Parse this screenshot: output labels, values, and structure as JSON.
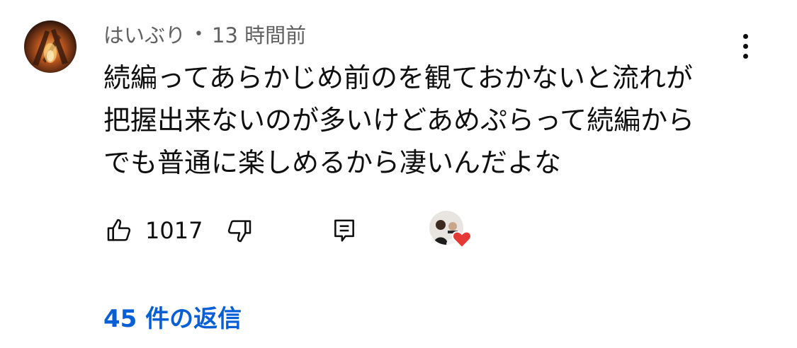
{
  "comment": {
    "author": "はいぶり",
    "separator": "•",
    "timestamp": "13 時間前",
    "text_lines": [
      "続編ってあらかじめ前のを観ておかないと流れが",
      "把握出来ないのが多いけどあめぷらって続編から",
      "でも普通に楽しめるから凄いんだよな"
    ]
  },
  "actions": {
    "like_icon": "thumbs-up-icon",
    "like_count": "1017",
    "dislike_icon": "thumbs-down-icon",
    "reply_icon": "reply-comment-icon",
    "creator_heart_icon": "heart-icon",
    "heart_color": "#e53935"
  },
  "replies": {
    "label": "45 件の返信",
    "color": "#065fd4"
  },
  "menu": {
    "icon": "more-vertical-icon"
  }
}
